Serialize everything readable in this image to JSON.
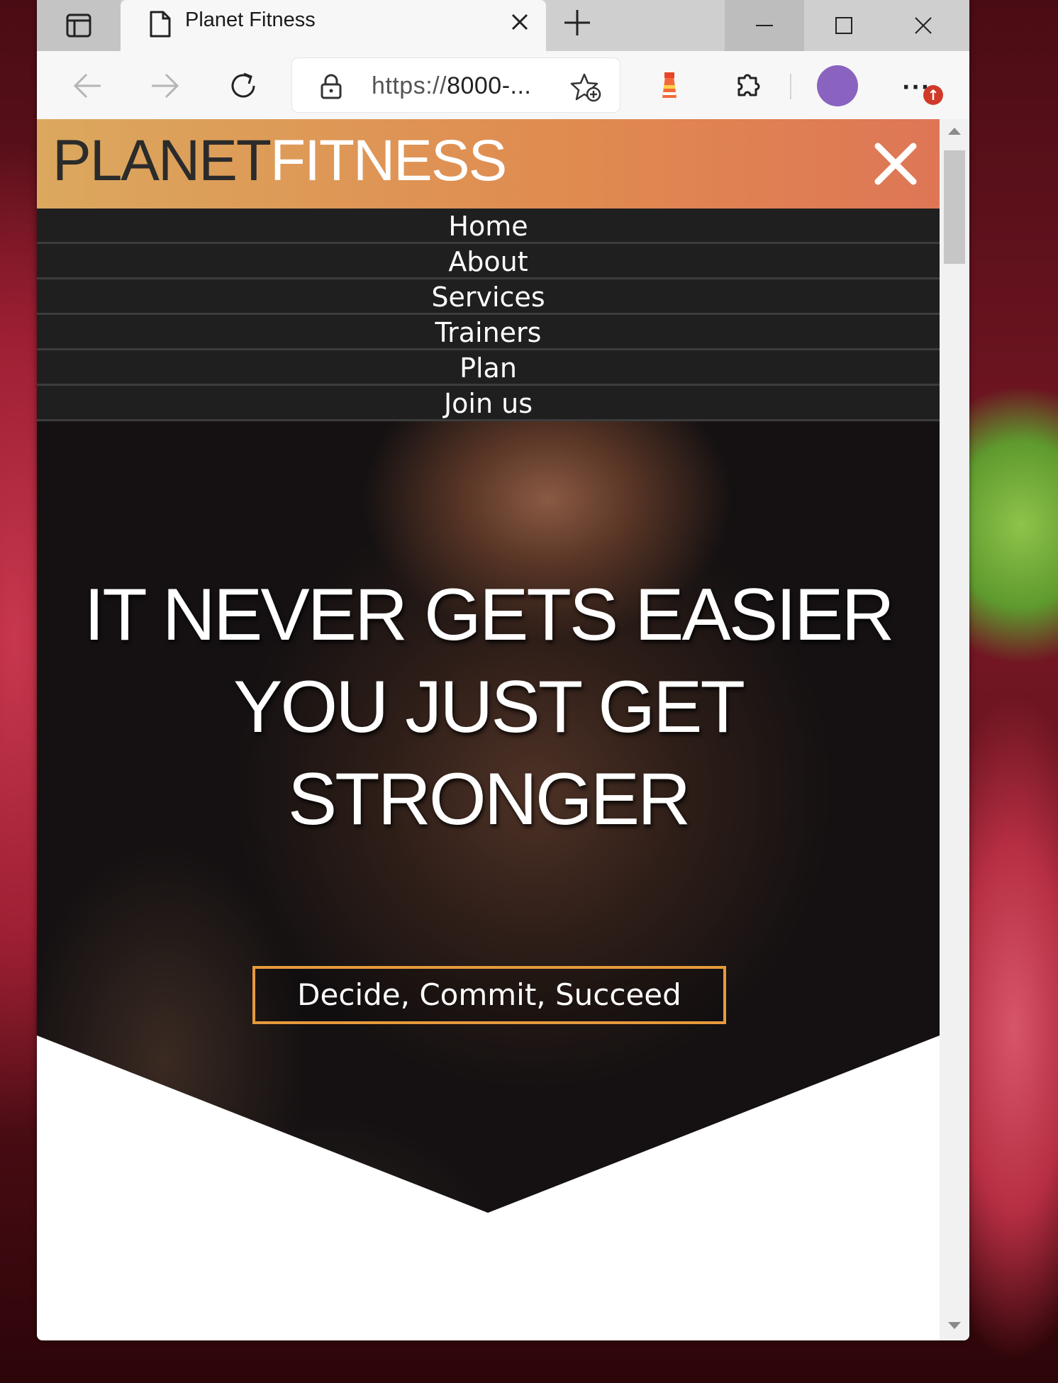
{
  "browser": {
    "tab_title": "Planet Fitness",
    "url_scheme": "https://",
    "url_host": "8000-..."
  },
  "site": {
    "logo_dark": "PLANET",
    "logo_light": "FITNESS",
    "nav": [
      "Home",
      "About",
      "Services",
      "Trainers",
      "Plan",
      "Join us"
    ],
    "hero_title_lines": [
      "IT NEVER GETS EASIER",
      "YOU JUST GET",
      "STRONGER"
    ],
    "cta_label": "Decide, Commit, Succeed"
  },
  "colors": {
    "header_gradient_start": "#dba85e",
    "header_gradient_end": "#de7656",
    "nav_bg": "#1f1f1f",
    "cta_border": "#e69a3c",
    "avatar": "#8a63c0"
  },
  "icons": {
    "extension_icon": "lighthouse-icon",
    "update_badge": "arrow-up-icon"
  }
}
